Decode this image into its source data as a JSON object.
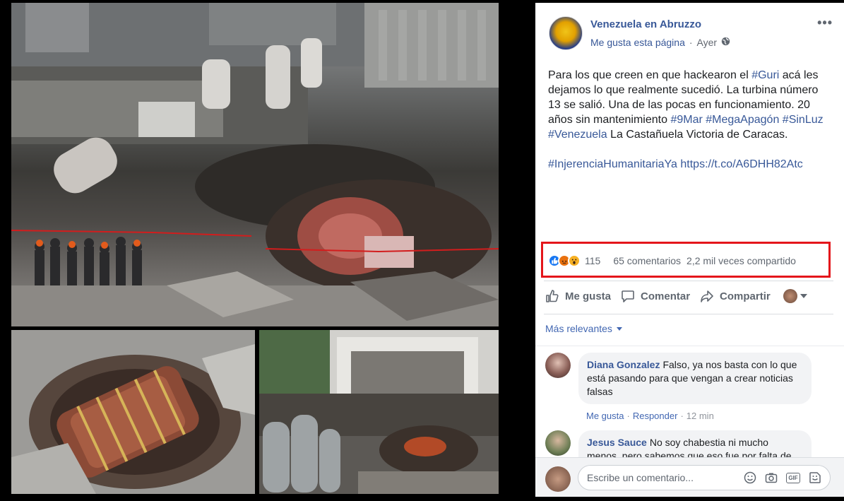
{
  "post": {
    "page_name": "Venezuela en Abruzzo",
    "like_page": "Me gusta esta página",
    "separator": "·",
    "time": "Ayer",
    "more_options": "•••",
    "text": {
      "p1": "Para los que creen en que hackearon el ",
      "tag_guri": "#Guri",
      "p2": " acá les dejamos lo que realmente sucedió. La turbina número 13 se salió. Una de las pocas en funcionamiento. 20 años sin mantenimiento ",
      "tag_9mar": "#9Mar",
      "tag_megaapagon": "#MegaApagón",
      "tag_sinluz": "#SinLuz",
      "tag_venezuela": "#Venezuela",
      "p3": " La Castañuela Victoria de Caracas.",
      "tag_injerencia": "#InjerenciaHumanitariaYa",
      "link": "https://t.co/A6DHH82Atc"
    },
    "reaction_count": "115",
    "comments_count": "65 comentarios",
    "shares_count": "2,2 mil veces compartido"
  },
  "actions": {
    "like": "Me gusta",
    "comment": "Comentar",
    "share": "Compartir"
  },
  "sort_label": "Más relevantes",
  "comments": [
    {
      "author": "Diana Gonzalez",
      "text": "Falso, ya nos basta con lo que está pasando para que vengan a crear noticias falsas",
      "like": "Me gusta",
      "reply": "Responder",
      "time": "12 min",
      "dot": "·"
    },
    {
      "author": "Jesus Sauce",
      "text": "No soy chabestia ni mucho menos, pero sabemos que eso fue por falta de mantenimiento"
    }
  ],
  "composer": {
    "placeholder": "Escribe un comentario...",
    "gif_label": "GIF"
  },
  "colors": {
    "link_blue": "#385898",
    "highlight_red": "#e4161b",
    "like_reaction": "#1877f2",
    "angry_reaction": "#e9710f",
    "wow_reaction": "#f7b125"
  }
}
